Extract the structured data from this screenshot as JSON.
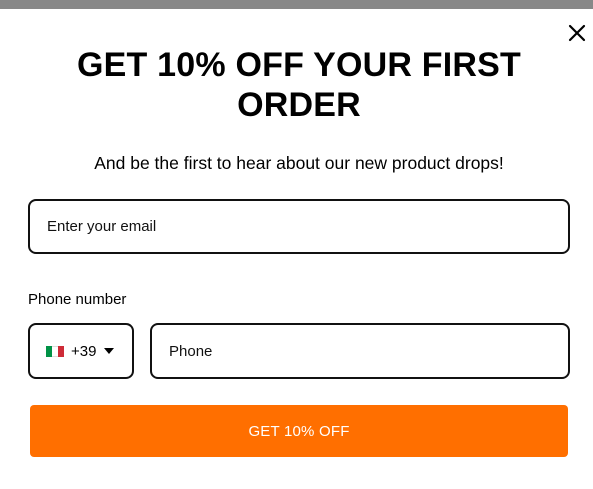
{
  "header": {
    "title": "GET 10% OFF YOUR FIRST ORDER",
    "subtitle": "And be the first to hear about our new product drops!"
  },
  "form": {
    "email": {
      "value": "",
      "placeholder": "Enter your email"
    },
    "phone": {
      "label": "Phone number",
      "country": {
        "flag_icon": "italy-flag-icon",
        "flag_colors": [
          "#009246",
          "#ffffff",
          "#ce2b37"
        ],
        "dial_code": "+39"
      },
      "value": "",
      "placeholder": "Phone"
    },
    "submit_label": "GET 10% OFF"
  },
  "close": {
    "icon": "close-icon"
  },
  "colors": {
    "accent": "#ff6f00",
    "top_bar": "#888888",
    "border": "#111111"
  }
}
